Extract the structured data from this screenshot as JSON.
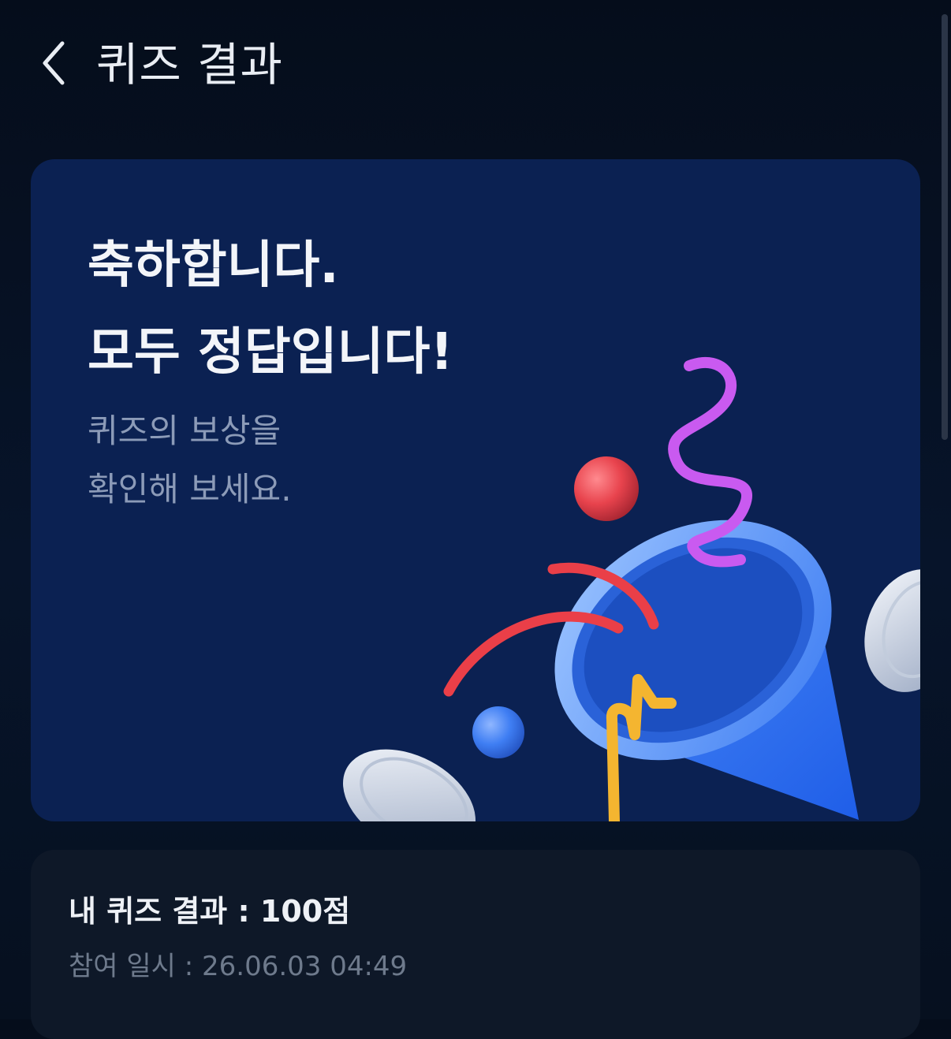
{
  "header": {
    "back_icon": "chevron-left-icon",
    "title": "퀴즈 결과"
  },
  "banner": {
    "headline_line1": "축하합니다.",
    "headline_line2": "모두 정답입니다!",
    "subtext_line1": "퀴즈의 보상을",
    "subtext_line2": "확인해 보세요.",
    "illustration": "party-popper-illustration",
    "background_color": "#0b2152"
  },
  "result": {
    "score_text": "내 퀴즈 결과 : 100점",
    "date_text": "참여 일시 : 26.06.03 04:49"
  }
}
